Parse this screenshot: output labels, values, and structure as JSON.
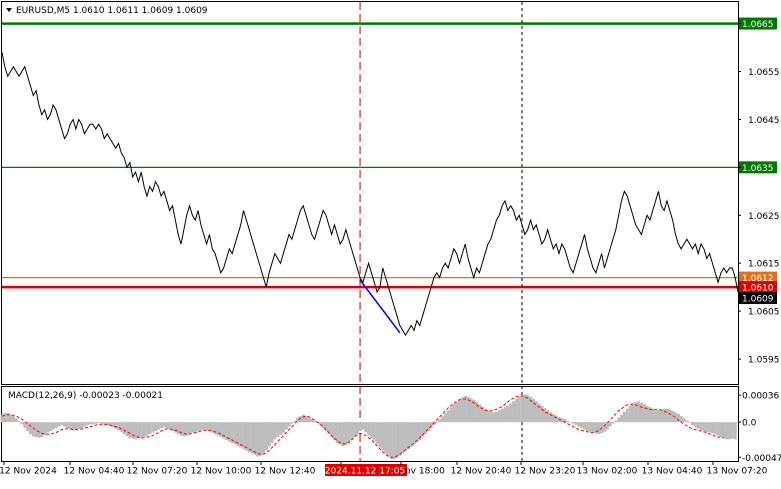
{
  "header": {
    "symbol_line": "EURUSD,M5  1.0610 1.0611 1.0609 1.0609",
    "macd_label": "MACD(12,26,9) -0.00023 -0.00021"
  },
  "chart_data": {
    "type": "line",
    "price_axis": {
      "ylim": [
        1.05898,
        1.06695
      ],
      "ticks": [
        "1.0665",
        "1.0655",
        "1.0645",
        "1.0635",
        "1.0625",
        "1.0615",
        "1.0605",
        "1.0595"
      ],
      "tick_values": [
        1.0665,
        1.0655,
        1.0645,
        1.0635,
        1.0625,
        1.0615,
        1.0605,
        1.0595
      ]
    },
    "macd_axis": {
      "ylim": [
        -0.00052,
        0.00047
      ],
      "ticks": [
        "0.00036",
        "0.0",
        "-0.00047"
      ],
      "tick_values": [
        0.00036,
        0.0,
        -0.00047
      ]
    },
    "time_labels": [
      "12 Nov 2024",
      "12 Nov 04:40",
      "12 Nov 07:20",
      "12 Nov 10:00",
      "12 Nov 12:40",
      "2024.11.12 17:05",
      "ov 18:00",
      "12 Nov 20:40",
      "12 Nov 23:20",
      "13 Nov 02:00",
      "13 Nov 04:40",
      "13 Nov 07:20"
    ],
    "time_label_x": [
      28,
      94,
      157,
      221,
      285,
      365,
      425,
      481,
      545,
      607,
      672,
      737
    ],
    "horizontal_levels": [
      {
        "value": 1.0665,
        "label": "1.0665",
        "color": "#007700",
        "style": "thick"
      },
      {
        "value": 1.0635,
        "label": "1.0635",
        "color": "#007700",
        "style": "thin"
      },
      {
        "value": 1.0612,
        "label": "1.0612",
        "color": "#e07020",
        "style": "thin"
      },
      {
        "value": 1.061,
        "label": "1.0610",
        "color": "#e00000",
        "style": "thick"
      }
    ],
    "current_price_label": "1.0609",
    "vertical_markers": [
      {
        "x_index": 126,
        "color": "#cc0000",
        "style": "dashed"
      },
      {
        "x_index": 183,
        "color": "#000000",
        "style": "dotted"
      }
    ],
    "trend_line": {
      "from_index": 126,
      "to_index": 140,
      "from_value": 1.06115,
      "to_value": 1.06005,
      "color": "#0000dd"
    },
    "price_series": [
      1.0659,
      1.0656,
      1.0654,
      1.0655,
      1.0656,
      1.0655,
      1.0654,
      1.0655,
      1.0656,
      1.0654,
      1.0652,
      1.065,
      1.0651,
      1.0648,
      1.0646,
      1.0647,
      1.0645,
      1.0646,
      1.0648,
      1.0647,
      1.0645,
      1.0643,
      1.0641,
      1.0642,
      1.0644,
      1.0645,
      1.0643,
      1.0645,
      1.0644,
      1.0642,
      1.0643,
      1.0644,
      1.0644,
      1.0643,
      1.0644,
      1.0643,
      1.0641,
      1.0642,
      1.0641,
      1.064,
      1.0639,
      1.064,
      1.0638,
      1.0637,
      1.0635,
      1.0636,
      1.0633,
      1.0634,
      1.0632,
      1.0634,
      1.0631,
      1.0629,
      1.0631,
      1.063,
      1.0632,
      1.0631,
      1.0629,
      1.063,
      1.0628,
      1.0626,
      1.0627,
      1.0624,
      1.0621,
      1.0619,
      1.0622,
      1.0625,
      1.0627,
      1.0625,
      1.0624,
      1.0626,
      1.0623,
      1.0621,
      1.0619,
      1.0621,
      1.0618,
      1.0617,
      1.0615,
      1.0613,
      1.0614,
      1.0616,
      1.0618,
      1.0617,
      1.0619,
      1.0621,
      1.0623,
      1.0626,
      1.0624,
      1.0622,
      1.062,
      1.0618,
      1.0616,
      1.0614,
      1.0612,
      1.061,
      1.0613,
      1.0615,
      1.0617,
      1.0616,
      1.0615,
      1.0617,
      1.0619,
      1.0621,
      1.062,
      1.0622,
      1.0624,
      1.0626,
      1.0627,
      1.0625,
      1.0623,
      1.0621,
      1.062,
      1.0622,
      1.0624,
      1.0626,
      1.0625,
      1.0623,
      1.0621,
      1.0623,
      1.0621,
      1.0619,
      1.062,
      1.0622,
      1.062,
      1.0618,
      1.0616,
      1.0614,
      1.0612,
      1.0611,
      1.0613,
      1.0615,
      1.0613,
      1.0611,
      1.0609,
      1.061,
      1.0614,
      1.0612,
      1.061,
      1.0608,
      1.0606,
      1.0604,
      1.0602,
      1.0601,
      1.06,
      1.0601,
      1.0602,
      1.0601,
      1.0603,
      1.0602,
      1.0604,
      1.0606,
      1.0608,
      1.061,
      1.0612,
      1.0613,
      1.0612,
      1.0614,
      1.0615,
      1.0614,
      1.0616,
      1.0618,
      1.0617,
      1.0615,
      1.0617,
      1.0619,
      1.0616,
      1.0614,
      1.0612,
      1.0614,
      1.0613,
      1.0615,
      1.0617,
      1.0619,
      1.062,
      1.0622,
      1.0624,
      1.0625,
      1.0627,
      1.0628,
      1.0626,
      1.0627,
      1.0626,
      1.0624,
      1.0625,
      1.0623,
      1.0621,
      1.0622,
      1.0624,
      1.0622,
      1.0623,
      1.0621,
      1.0619,
      1.062,
      1.0622,
      1.062,
      1.0618,
      1.0619,
      1.0617,
      1.0619,
      1.0618,
      1.0616,
      1.0614,
      1.0613,
      1.0615,
      1.0617,
      1.0619,
      1.0621,
      1.0618,
      1.0616,
      1.0614,
      1.0613,
      1.0615,
      1.0617,
      1.0614,
      1.0616,
      1.0618,
      1.062,
      1.0622,
      1.0625,
      1.0628,
      1.063,
      1.0629,
      1.0627,
      1.0625,
      1.0623,
      1.0622,
      1.0621,
      1.0623,
      1.0625,
      1.0624,
      1.0626,
      1.0628,
      1.063,
      1.0627,
      1.0626,
      1.0628,
      1.0626,
      1.0624,
      1.0621,
      1.0619,
      1.0618,
      1.0619,
      1.062,
      1.0619,
      1.0618,
      1.0619,
      1.0617,
      1.0619,
      1.0618,
      1.0616,
      1.0617,
      1.0615,
      1.0613,
      1.0611,
      1.0613,
      1.0614,
      1.0613,
      1.0614,
      1.0614,
      1.0612,
      1.0609
    ],
    "macd_hist": [
      0.0001,
      0.00012,
      0.00012,
      0.0001,
      8e-05,
      5e-05,
      1e-05,
      -3e-05,
      -8e-05,
      -0.00012,
      -0.00016,
      -0.00019,
      -0.0002,
      -0.00021,
      -0.0002,
      -0.00017,
      -0.00014,
      -0.00012,
      -0.0001,
      -8e-05,
      -6e-05,
      -4e-05,
      -6e-05,
      -8e-05,
      -0.0001,
      -0.00011,
      -0.0001,
      -9e-05,
      -8e-05,
      -6e-05,
      -4e-05,
      -3e-05,
      -3e-05,
      -2e-05,
      -1e-05,
      -2e-05,
      -3e-05,
      -4e-05,
      -5e-05,
      -7e-05,
      -9e-05,
      -0.00011,
      -0.00013,
      -0.00016,
      -0.00019,
      -0.00021,
      -0.00022,
      -0.00023,
      -0.00022,
      -0.00021,
      -0.0002,
      -0.00018,
      -0.00016,
      -0.00014,
      -0.00012,
      -0.0001,
      -8e-05,
      -7e-05,
      -8e-05,
      -0.0001,
      -0.00012,
      -0.00014,
      -0.00016,
      -0.00018,
      -0.00019,
      -0.00018,
      -0.00016,
      -0.00014,
      -0.00013,
      -0.00012,
      -0.00011,
      -0.0001,
      -0.00011,
      -0.00012,
      -0.00014,
      -0.00016,
      -0.00018,
      -0.0002,
      -0.00022,
      -0.00024,
      -0.00026,
      -0.00028,
      -0.0003,
      -0.00032,
      -0.00034,
      -0.00036,
      -0.00038,
      -0.0004,
      -0.00042,
      -0.00044,
      -0.00046,
      -0.00045,
      -0.00042,
      -0.00038,
      -0.00033,
      -0.00028,
      -0.00023,
      -0.0002,
      -0.00017,
      -0.00014,
      -0.0001,
      -6e-05,
      -2e-05,
      2e-05,
      6e-05,
      8e-05,
      0.0001,
      8e-05,
      6e-05,
      4e-05,
      2e-05,
      -1e-05,
      -4e-05,
      -8e-05,
      -0.00012,
      -0.00016,
      -0.0002,
      -0.00024,
      -0.00028,
      -0.0003,
      -0.00032,
      -0.00031,
      -0.00028,
      -0.00024,
      -0.0002,
      -0.00016,
      -0.00012,
      -0.0001,
      -0.00014,
      -0.00018,
      -0.00022,
      -0.00026,
      -0.0003,
      -0.00034,
      -0.00038,
      -0.00042,
      -0.00046,
      -0.00049,
      -0.0005,
      -0.00048,
      -0.00045,
      -0.00042,
      -0.00039,
      -0.00036,
      -0.00033,
      -0.0003,
      -0.00027,
      -0.00024,
      -0.0002,
      -0.00016,
      -0.00012,
      -8e-05,
      -4e-05,
      0.0,
      4e-05,
      8e-05,
      0.00012,
      0.00016,
      0.0002,
      0.00024,
      0.00027,
      0.0003,
      0.00033,
      0.00035,
      0.00034,
      0.00032,
      0.0003,
      0.00027,
      0.00024,
      0.00021,
      0.00018,
      0.00016,
      0.00014,
      0.00013,
      0.00014,
      0.00016,
      0.00018,
      0.0002,
      0.00022,
      0.00025,
      0.00028,
      0.00031,
      0.00034,
      0.00036,
      0.00037,
      0.00036,
      0.00034,
      0.00031,
      0.00028,
      0.00025,
      0.00022,
      0.00019,
      0.00016,
      0.00013,
      0.00011,
      9e-05,
      7e-05,
      5e-05,
      4e-05,
      2e-05,
      0.0,
      -2e-05,
      -4e-05,
      -6e-05,
      -8e-05,
      -0.0001,
      -0.00012,
      -0.00013,
      -0.00014,
      -0.00015,
      -0.00016,
      -0.00015,
      -0.00013,
      -0.0001,
      -6e-05,
      -2e-05,
      2e-05,
      6e-05,
      0.0001,
      0.00014,
      0.00018,
      0.00022,
      0.00025,
      0.00027,
      0.00028,
      0.00026,
      0.00024,
      0.00022,
      0.0002,
      0.00018,
      0.00016,
      0.00016,
      0.00017,
      0.00018,
      0.00018,
      0.00017,
      0.00015,
      0.00013,
      0.00011,
      8e-05,
      5e-05,
      2e-05,
      -1e-05,
      -4e-05,
      -7e-05,
      -9e-05,
      -0.00011,
      -0.00012,
      -0.00013,
      -0.00014,
      -0.00015,
      -0.00016,
      -0.00018,
      -0.0002,
      -0.00022,
      -0.00023,
      -0.00023,
      -0.00022,
      -0.00023
    ],
    "macd_signal": [
      8e-05,
      9e-05,
      0.0001,
      0.0001,
      9e-05,
      8e-05,
      6e-05,
      4e-05,
      1e-05,
      -2e-05,
      -5e-05,
      -8e-05,
      -0.00011,
      -0.00013,
      -0.00015,
      -0.00016,
      -0.00016,
      -0.00016,
      -0.00015,
      -0.00014,
      -0.00012,
      -0.0001,
      -9e-05,
      -9e-05,
      -9e-05,
      -0.0001,
      -0.0001,
      -0.0001,
      -9e-05,
      -8e-05,
      -7e-05,
      -6e-05,
      -5e-05,
      -4e-05,
      -3e-05,
      -3e-05,
      -3e-05,
      -3e-05,
      -4e-05,
      -5e-05,
      -6e-05,
      -7e-05,
      -9e-05,
      -0.00011,
      -0.00013,
      -0.00015,
      -0.00017,
      -0.00019,
      -0.0002,
      -0.00021,
      -0.00021,
      -0.0002,
      -0.00019,
      -0.00018,
      -0.00016,
      -0.00014,
      -0.00012,
      -0.0001,
      -9e-05,
      -9e-05,
      -0.0001,
      -0.00011,
      -0.00012,
      -0.00014,
      -0.00015,
      -0.00016,
      -0.00016,
      -0.00015,
      -0.00014,
      -0.00013,
      -0.00012,
      -0.00011,
      -0.00011,
      -0.00011,
      -0.00012,
      -0.00013,
      -0.00014,
      -0.00016,
      -0.00018,
      -0.0002,
      -0.00022,
      -0.00024,
      -0.00026,
      -0.00028,
      -0.0003,
      -0.00032,
      -0.00034,
      -0.00036,
      -0.00038,
      -0.0004,
      -0.00042,
      -0.00043,
      -0.00043,
      -0.00041,
      -0.00038,
      -0.00034,
      -0.0003,
      -0.00026,
      -0.00022,
      -0.00018,
      -0.00014,
      -0.0001,
      -6e-05,
      -2e-05,
      2e-05,
      5e-05,
      7e-05,
      8e-05,
      7e-05,
      5e-05,
      3e-05,
      0.0,
      -3e-05,
      -6e-05,
      -0.0001,
      -0.00014,
      -0.00018,
      -0.00022,
      -0.00025,
      -0.00028,
      -0.00029,
      -0.00029,
      -0.00027,
      -0.00024,
      -0.0002,
      -0.00017,
      -0.00015,
      -0.00016,
      -0.00018,
      -0.00021,
      -0.00024,
      -0.00028,
      -0.00032,
      -0.00036,
      -0.0004,
      -0.00043,
      -0.00046,
      -0.00047,
      -0.00047,
      -0.00045,
      -0.00043,
      -0.0004,
      -0.00037,
      -0.00034,
      -0.00031,
      -0.00028,
      -0.00025,
      -0.00021,
      -0.00017,
      -0.00013,
      -9e-05,
      -5e-05,
      -1e-05,
      3e-05,
      7e-05,
      0.00011,
      0.00015,
      0.00019,
      0.00022,
      0.00025,
      0.00028,
      0.0003,
      0.00031,
      0.00031,
      0.0003,
      0.00028,
      0.00026,
      0.00023,
      0.0002,
      0.00018,
      0.00016,
      0.00015,
      0.00015,
      0.00016,
      0.00017,
      0.00019,
      0.00021,
      0.00024,
      0.00027,
      0.0003,
      0.00032,
      0.00034,
      0.00035,
      0.00035,
      0.00034,
      0.00032,
      0.00029,
      0.00026,
      0.00023,
      0.0002,
      0.00017,
      0.00014,
      0.00012,
      0.0001,
      8e-05,
      6e-05,
      4e-05,
      2e-05,
      0.0,
      -2e-05,
      -4e-05,
      -6e-05,
      -8e-05,
      -0.0001,
      -0.00011,
      -0.00012,
      -0.00013,
      -0.00014,
      -0.00014,
      -0.00013,
      -0.00011,
      -8e-05,
      -5e-05,
      -1e-05,
      3e-05,
      7e-05,
      0.00011,
      0.00015,
      0.00018,
      0.00021,
      0.00023,
      0.00024,
      0.00024,
      0.00023,
      0.00022,
      0.0002,
      0.00019,
      0.00018,
      0.00017,
      0.00017,
      0.00017,
      0.00017,
      0.00016,
      0.00015,
      0.00013,
      0.00011,
      9e-05,
      6e-05,
      3e-05,
      0.0,
      -3e-05,
      -5e-05,
      -7e-05,
      -9e-05,
      -0.0001,
      -0.00011,
      -0.00012,
      -0.00013,
      -0.00014,
      -0.00016,
      -0.00017,
      -0.00019,
      -0.0002,
      -0.0002,
      -0.00021
    ],
    "colors": {
      "price_line": "#000000",
      "macd_hist": "#bdbdbd",
      "macd_signal": "#ff0000",
      "axis": "#000000",
      "bg": "#ffffff",
      "label_text": "#ffffff",
      "current_price_bg": "#000000"
    }
  }
}
